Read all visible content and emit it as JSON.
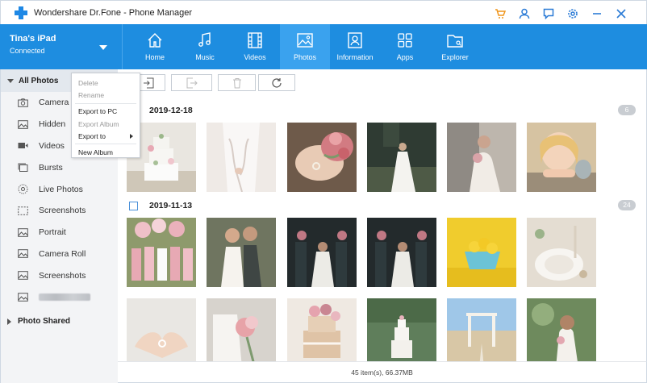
{
  "app": {
    "title": "Wondershare Dr.Fone - Phone Manager"
  },
  "device": {
    "name": "Tina's iPad",
    "status": "Connected"
  },
  "nav": {
    "tabs": [
      {
        "label": "Home",
        "icon": "home-icon",
        "active": false
      },
      {
        "label": "Music",
        "icon": "music-icon",
        "active": false
      },
      {
        "label": "Videos",
        "icon": "film-icon",
        "active": false
      },
      {
        "label": "Photos",
        "icon": "image-icon",
        "active": true
      },
      {
        "label": "Information",
        "icon": "contact-card-icon",
        "active": false
      },
      {
        "label": "Apps",
        "icon": "apps-grid-icon",
        "active": false
      },
      {
        "label": "Explorer",
        "icon": "folder-icon",
        "active": false
      }
    ]
  },
  "sidebar": {
    "header": "All Photos",
    "items": [
      {
        "label": "Camera",
        "icon": "camera-icon"
      },
      {
        "label": "Hidden",
        "icon": "hidden-image-icon"
      },
      {
        "label": "Videos",
        "icon": "video-icon"
      },
      {
        "label": "Bursts",
        "icon": "stacked-photos-icon"
      },
      {
        "label": "Live Photos",
        "icon": "live-photo-icon"
      },
      {
        "label": "Screenshots",
        "icon": "screenshot-icon"
      },
      {
        "label": "Portrait",
        "icon": "portrait-icon"
      },
      {
        "label": "Camera Roll",
        "icon": "image-icon"
      },
      {
        "label": "Screenshots",
        "icon": "image-icon"
      },
      {
        "label": "",
        "icon": "image-icon",
        "blurred": true
      }
    ],
    "footer": "Photo Shared"
  },
  "context_menu": {
    "items": [
      {
        "label": "Delete",
        "disabled": true
      },
      {
        "label": "Rename",
        "disabled": true
      },
      {
        "label": "Export to PC",
        "disabled": false
      },
      {
        "label": "Export Album",
        "disabled": true
      },
      {
        "label": "Export to",
        "disabled": false,
        "submenu": true
      },
      {
        "label": "New Album",
        "disabled": false
      }
    ]
  },
  "toolbar": {
    "buttons": [
      {
        "name": "import-button",
        "icon": "import-icon"
      },
      {
        "name": "export-button",
        "icon": "export-icon",
        "disabled": true
      },
      {
        "name": "delete-button",
        "icon": "trash-icon",
        "disabled": true
      },
      {
        "name": "refresh-button",
        "icon": "refresh-icon"
      }
    ]
  },
  "groups": [
    {
      "date": "2019-12-18",
      "count": "6"
    },
    {
      "date": "2019-11-13",
      "count": "24"
    }
  ],
  "status": {
    "summary": "45 item(s), 66.37MB"
  },
  "colors": {
    "accent": "#1e8de0",
    "active_tab": "#3aa2ee",
    "title_icons": "#2b7bd6",
    "cart_icon": "#f0961c"
  }
}
